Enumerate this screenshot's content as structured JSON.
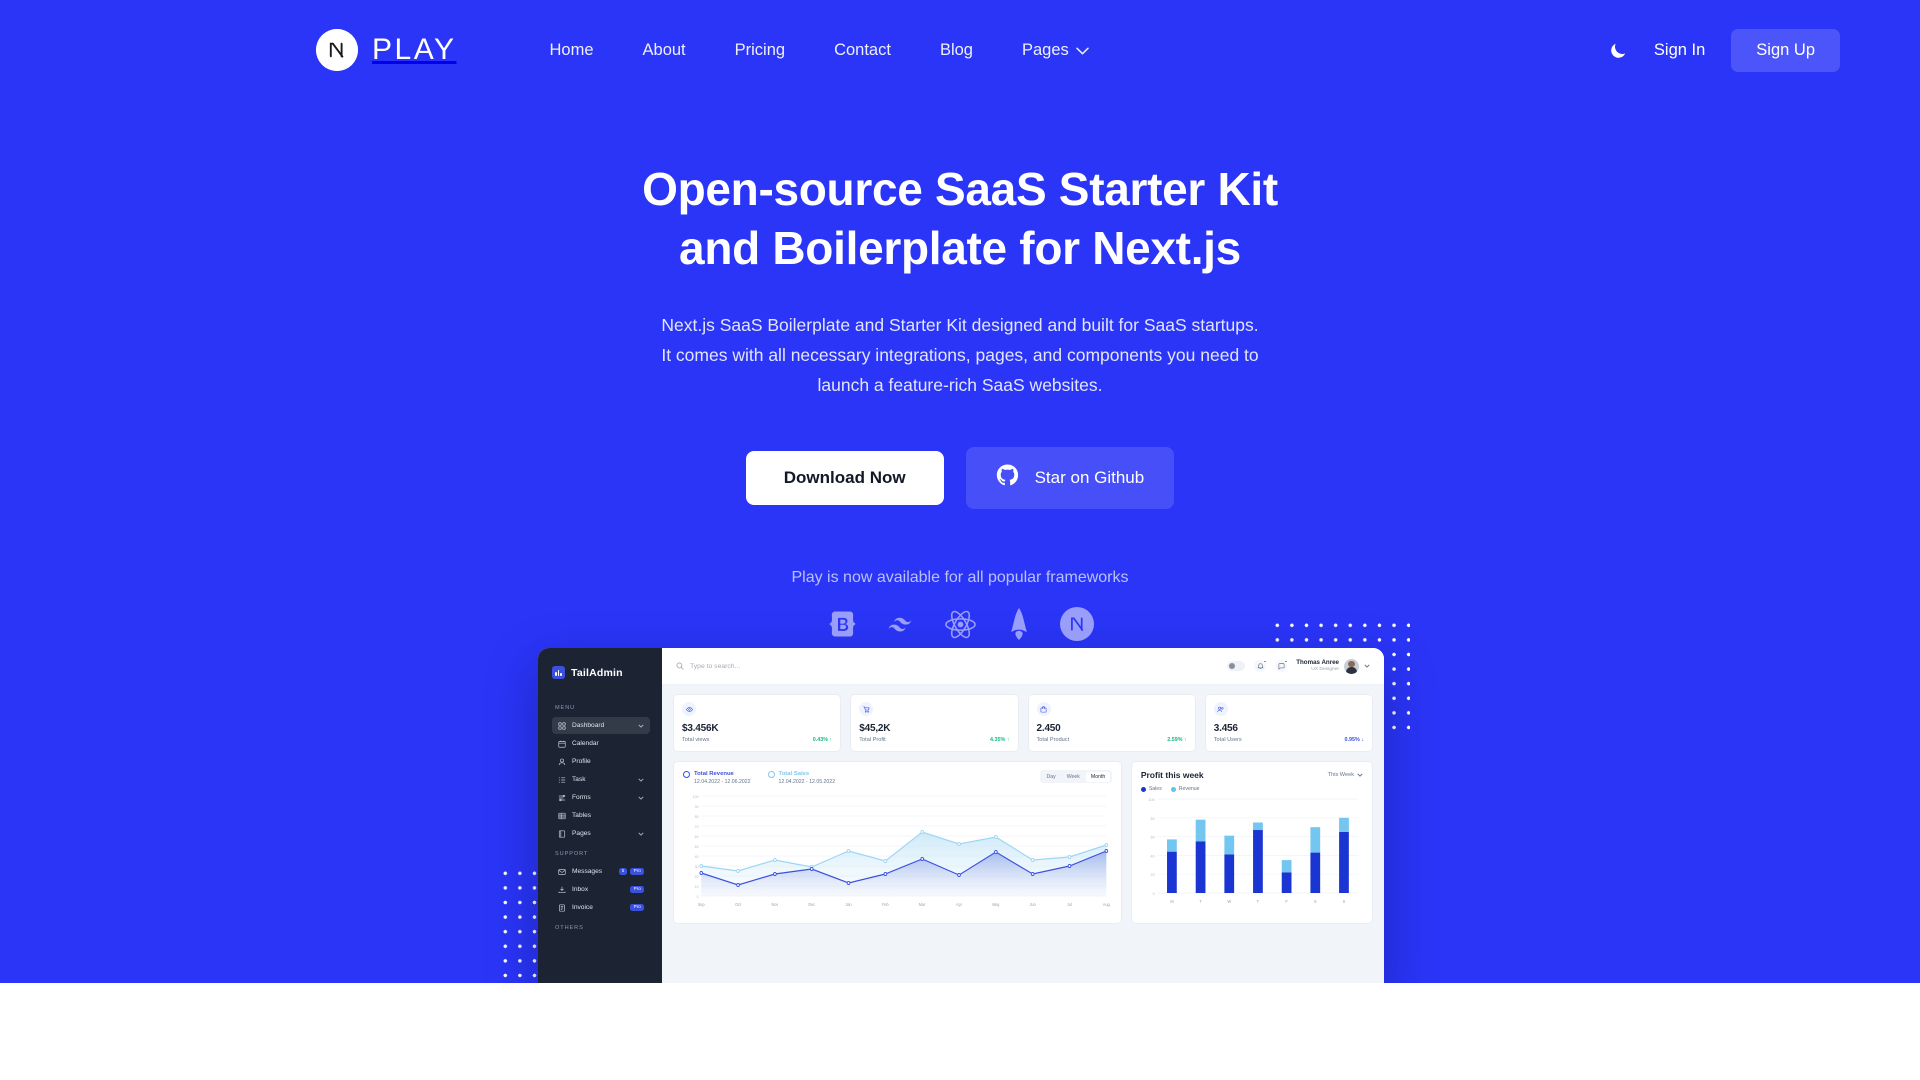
{
  "brand": {
    "name": "PLAY",
    "logo_icon": "nextjs-circle-icon"
  },
  "nav": {
    "links": [
      {
        "label": "Home"
      },
      {
        "label": "About"
      },
      {
        "label": "Pricing"
      },
      {
        "label": "Contact"
      },
      {
        "label": "Blog"
      },
      {
        "label": "Pages",
        "has_dropdown": true
      }
    ],
    "theme_toggle_icon": "moon-icon",
    "sign_in": "Sign In",
    "sign_up": "Sign Up"
  },
  "hero": {
    "title_line1": "Open-source SaaS Starter Kit",
    "title_line2": "and Boilerplate for Next.js",
    "subtitle": "Next.js SaaS Boilerplate and Starter Kit designed and built for SaaS startups. It comes with all necessary integrations, pages, and components you need to launch a feature-rich SaaS websites.",
    "primary_cta": "Download Now",
    "secondary_cta": "Star on Github",
    "secondary_cta_icon": "github-icon",
    "frameworks_label": "Play is now available for all popular frameworks",
    "frameworks": [
      {
        "name": "bootstrap-icon"
      },
      {
        "name": "tailwindcss-icon"
      },
      {
        "name": "react-icon"
      },
      {
        "name": "astro-icon"
      },
      {
        "name": "nextjs-icon"
      }
    ]
  },
  "colors": {
    "brand_blue": "#2a35f7",
    "button_blue": "#4b55f9",
    "accent_green": "#10b981",
    "dashboard_primary": "#3c50e0",
    "dashboard_sidebar": "#1c2434"
  },
  "dashboard": {
    "product_name": "TailAdmin",
    "sidebar": {
      "groups": [
        {
          "label": "MENU",
          "items": [
            {
              "label": "Dashboard",
              "icon": "grid-icon",
              "active": true,
              "chevron": true
            },
            {
              "label": "Calendar",
              "icon": "calendar-icon"
            },
            {
              "label": "Profile",
              "icon": "user-icon"
            },
            {
              "label": "Task",
              "icon": "list-icon",
              "chevron": true
            },
            {
              "label": "Forms",
              "icon": "forms-icon",
              "chevron": true
            },
            {
              "label": "Tables",
              "icon": "table-icon"
            },
            {
              "label": "Pages",
              "icon": "pages-icon",
              "chevron": true
            }
          ]
        },
        {
          "label": "SUPPORT",
          "items": [
            {
              "label": "Messages",
              "icon": "mail-icon",
              "badges": [
                "5",
                "Pro"
              ]
            },
            {
              "label": "Inbox",
              "icon": "inbox-icon",
              "badges": [
                "Pro"
              ]
            },
            {
              "label": "Invoice",
              "icon": "invoice-icon",
              "badges": [
                "Pro"
              ]
            }
          ]
        },
        {
          "label": "OTHERS",
          "items": []
        }
      ]
    },
    "topbar": {
      "search_placeholder": "Type to search...",
      "search_icon": "search-icon",
      "bell_icon": "bell-icon",
      "chat_icon": "chat-icon",
      "user_name": "Thomas Anree",
      "user_role": "UX Designer"
    },
    "stats": [
      {
        "value": "$3.456K",
        "label": "Total views",
        "delta": "0.43%",
        "direction": "up",
        "icon": "eye-icon"
      },
      {
        "value": "$45,2K",
        "label": "Total Profit",
        "delta": "4.35%",
        "direction": "up",
        "icon": "cart-icon"
      },
      {
        "value": "2.450",
        "label": "Total Product",
        "delta": "2.59%",
        "direction": "up",
        "icon": "bag-icon"
      },
      {
        "value": "3.456",
        "label": "Total Users",
        "delta": "0.95%",
        "direction": "down",
        "icon": "users-icon"
      }
    ],
    "revenue_chart": {
      "legend": [
        {
          "title": "Total Revenue",
          "range": "12.04.2022 - 12.06.2022"
        },
        {
          "title": "Total Sales",
          "range": "12.04.2022 - 12.05.2022"
        }
      ],
      "segments": [
        "Day",
        "Week",
        "Month"
      ],
      "selected_segment": "Month"
    },
    "profit_chart": {
      "title": "Profit this week",
      "period": "This Week",
      "legend": [
        "Sales",
        "Revenue"
      ]
    }
  },
  "chart_data": [
    {
      "type": "area",
      "title": "Total Revenue / Total Sales",
      "categories": [
        "Sep",
        "Oct",
        "Nov",
        "Dec",
        "Jan",
        "Feb",
        "Mar",
        "Apr",
        "May",
        "Jun",
        "Jul",
        "Aug"
      ],
      "series": [
        {
          "name": "Total Revenue",
          "values": [
            23,
            11,
            22,
            27,
            13,
            22,
            37,
            21,
            44,
            22,
            30,
            45
          ]
        },
        {
          "name": "Total Sales",
          "values": [
            30,
            25,
            36,
            29,
            45,
            35,
            64,
            52,
            59,
            36,
            39,
            51
          ]
        }
      ],
      "ylim": [
        0,
        100
      ],
      "yticks": [
        0,
        10,
        20,
        30,
        40,
        50,
        60,
        70,
        80,
        90,
        100
      ],
      "xlabel": "",
      "ylabel": "",
      "grid": true,
      "legend_position": "top-left"
    },
    {
      "type": "bar",
      "title": "Profit this week",
      "categories": [
        "M",
        "T",
        "W",
        "T",
        "F",
        "S",
        "S"
      ],
      "series": [
        {
          "name": "Sales",
          "values": [
            44,
            55,
            41,
            67,
            22,
            43,
            65
          ]
        },
        {
          "name": "Revenue",
          "values": [
            13,
            23,
            20,
            8,
            13,
            27,
            15
          ]
        }
      ],
      "stacked": true,
      "ylim": [
        0,
        100
      ],
      "yticks": [
        0,
        20,
        40,
        60,
        80,
        100
      ],
      "grid": true,
      "legend_position": "top-left"
    }
  ]
}
